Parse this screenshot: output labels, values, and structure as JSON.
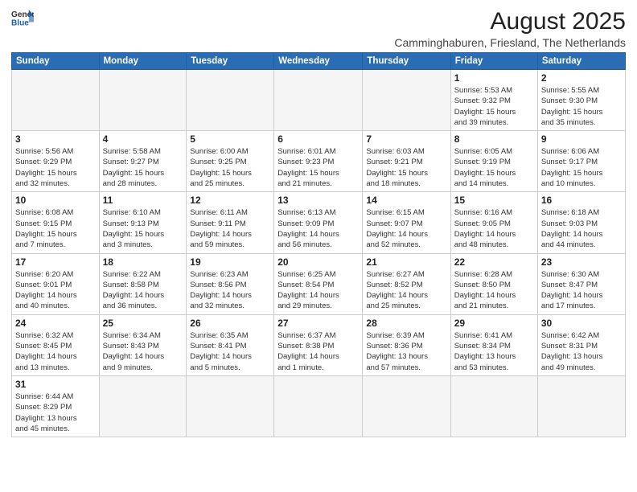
{
  "header": {
    "logo_line1": "General",
    "logo_line2": "Blue",
    "main_title": "August 2025",
    "subtitle": "Camminghaburen, Friesland, The Netherlands"
  },
  "weekdays": [
    "Sunday",
    "Monday",
    "Tuesday",
    "Wednesday",
    "Thursday",
    "Friday",
    "Saturday"
  ],
  "weeks": [
    [
      {
        "day": "",
        "info": ""
      },
      {
        "day": "",
        "info": ""
      },
      {
        "day": "",
        "info": ""
      },
      {
        "day": "",
        "info": ""
      },
      {
        "day": "",
        "info": ""
      },
      {
        "day": "1",
        "info": "Sunrise: 5:53 AM\nSunset: 9:32 PM\nDaylight: 15 hours\nand 39 minutes."
      },
      {
        "day": "2",
        "info": "Sunrise: 5:55 AM\nSunset: 9:30 PM\nDaylight: 15 hours\nand 35 minutes."
      }
    ],
    [
      {
        "day": "3",
        "info": "Sunrise: 5:56 AM\nSunset: 9:29 PM\nDaylight: 15 hours\nand 32 minutes."
      },
      {
        "day": "4",
        "info": "Sunrise: 5:58 AM\nSunset: 9:27 PM\nDaylight: 15 hours\nand 28 minutes."
      },
      {
        "day": "5",
        "info": "Sunrise: 6:00 AM\nSunset: 9:25 PM\nDaylight: 15 hours\nand 25 minutes."
      },
      {
        "day": "6",
        "info": "Sunrise: 6:01 AM\nSunset: 9:23 PM\nDaylight: 15 hours\nand 21 minutes."
      },
      {
        "day": "7",
        "info": "Sunrise: 6:03 AM\nSunset: 9:21 PM\nDaylight: 15 hours\nand 18 minutes."
      },
      {
        "day": "8",
        "info": "Sunrise: 6:05 AM\nSunset: 9:19 PM\nDaylight: 15 hours\nand 14 minutes."
      },
      {
        "day": "9",
        "info": "Sunrise: 6:06 AM\nSunset: 9:17 PM\nDaylight: 15 hours\nand 10 minutes."
      }
    ],
    [
      {
        "day": "10",
        "info": "Sunrise: 6:08 AM\nSunset: 9:15 PM\nDaylight: 15 hours\nand 7 minutes."
      },
      {
        "day": "11",
        "info": "Sunrise: 6:10 AM\nSunset: 9:13 PM\nDaylight: 15 hours\nand 3 minutes."
      },
      {
        "day": "12",
        "info": "Sunrise: 6:11 AM\nSunset: 9:11 PM\nDaylight: 14 hours\nand 59 minutes."
      },
      {
        "day": "13",
        "info": "Sunrise: 6:13 AM\nSunset: 9:09 PM\nDaylight: 14 hours\nand 56 minutes."
      },
      {
        "day": "14",
        "info": "Sunrise: 6:15 AM\nSunset: 9:07 PM\nDaylight: 14 hours\nand 52 minutes."
      },
      {
        "day": "15",
        "info": "Sunrise: 6:16 AM\nSunset: 9:05 PM\nDaylight: 14 hours\nand 48 minutes."
      },
      {
        "day": "16",
        "info": "Sunrise: 6:18 AM\nSunset: 9:03 PM\nDaylight: 14 hours\nand 44 minutes."
      }
    ],
    [
      {
        "day": "17",
        "info": "Sunrise: 6:20 AM\nSunset: 9:01 PM\nDaylight: 14 hours\nand 40 minutes."
      },
      {
        "day": "18",
        "info": "Sunrise: 6:22 AM\nSunset: 8:58 PM\nDaylight: 14 hours\nand 36 minutes."
      },
      {
        "day": "19",
        "info": "Sunrise: 6:23 AM\nSunset: 8:56 PM\nDaylight: 14 hours\nand 32 minutes."
      },
      {
        "day": "20",
        "info": "Sunrise: 6:25 AM\nSunset: 8:54 PM\nDaylight: 14 hours\nand 29 minutes."
      },
      {
        "day": "21",
        "info": "Sunrise: 6:27 AM\nSunset: 8:52 PM\nDaylight: 14 hours\nand 25 minutes."
      },
      {
        "day": "22",
        "info": "Sunrise: 6:28 AM\nSunset: 8:50 PM\nDaylight: 14 hours\nand 21 minutes."
      },
      {
        "day": "23",
        "info": "Sunrise: 6:30 AM\nSunset: 8:47 PM\nDaylight: 14 hours\nand 17 minutes."
      }
    ],
    [
      {
        "day": "24",
        "info": "Sunrise: 6:32 AM\nSunset: 8:45 PM\nDaylight: 14 hours\nand 13 minutes."
      },
      {
        "day": "25",
        "info": "Sunrise: 6:34 AM\nSunset: 8:43 PM\nDaylight: 14 hours\nand 9 minutes."
      },
      {
        "day": "26",
        "info": "Sunrise: 6:35 AM\nSunset: 8:41 PM\nDaylight: 14 hours\nand 5 minutes."
      },
      {
        "day": "27",
        "info": "Sunrise: 6:37 AM\nSunset: 8:38 PM\nDaylight: 14 hours\nand 1 minute."
      },
      {
        "day": "28",
        "info": "Sunrise: 6:39 AM\nSunset: 8:36 PM\nDaylight: 13 hours\nand 57 minutes."
      },
      {
        "day": "29",
        "info": "Sunrise: 6:41 AM\nSunset: 8:34 PM\nDaylight: 13 hours\nand 53 minutes."
      },
      {
        "day": "30",
        "info": "Sunrise: 6:42 AM\nSunset: 8:31 PM\nDaylight: 13 hours\nand 49 minutes."
      }
    ],
    [
      {
        "day": "31",
        "info": "Sunrise: 6:44 AM\nSunset: 8:29 PM\nDaylight: 13 hours\nand 45 minutes."
      },
      {
        "day": "",
        "info": ""
      },
      {
        "day": "",
        "info": ""
      },
      {
        "day": "",
        "info": ""
      },
      {
        "day": "",
        "info": ""
      },
      {
        "day": "",
        "info": ""
      },
      {
        "day": "",
        "info": ""
      }
    ]
  ]
}
